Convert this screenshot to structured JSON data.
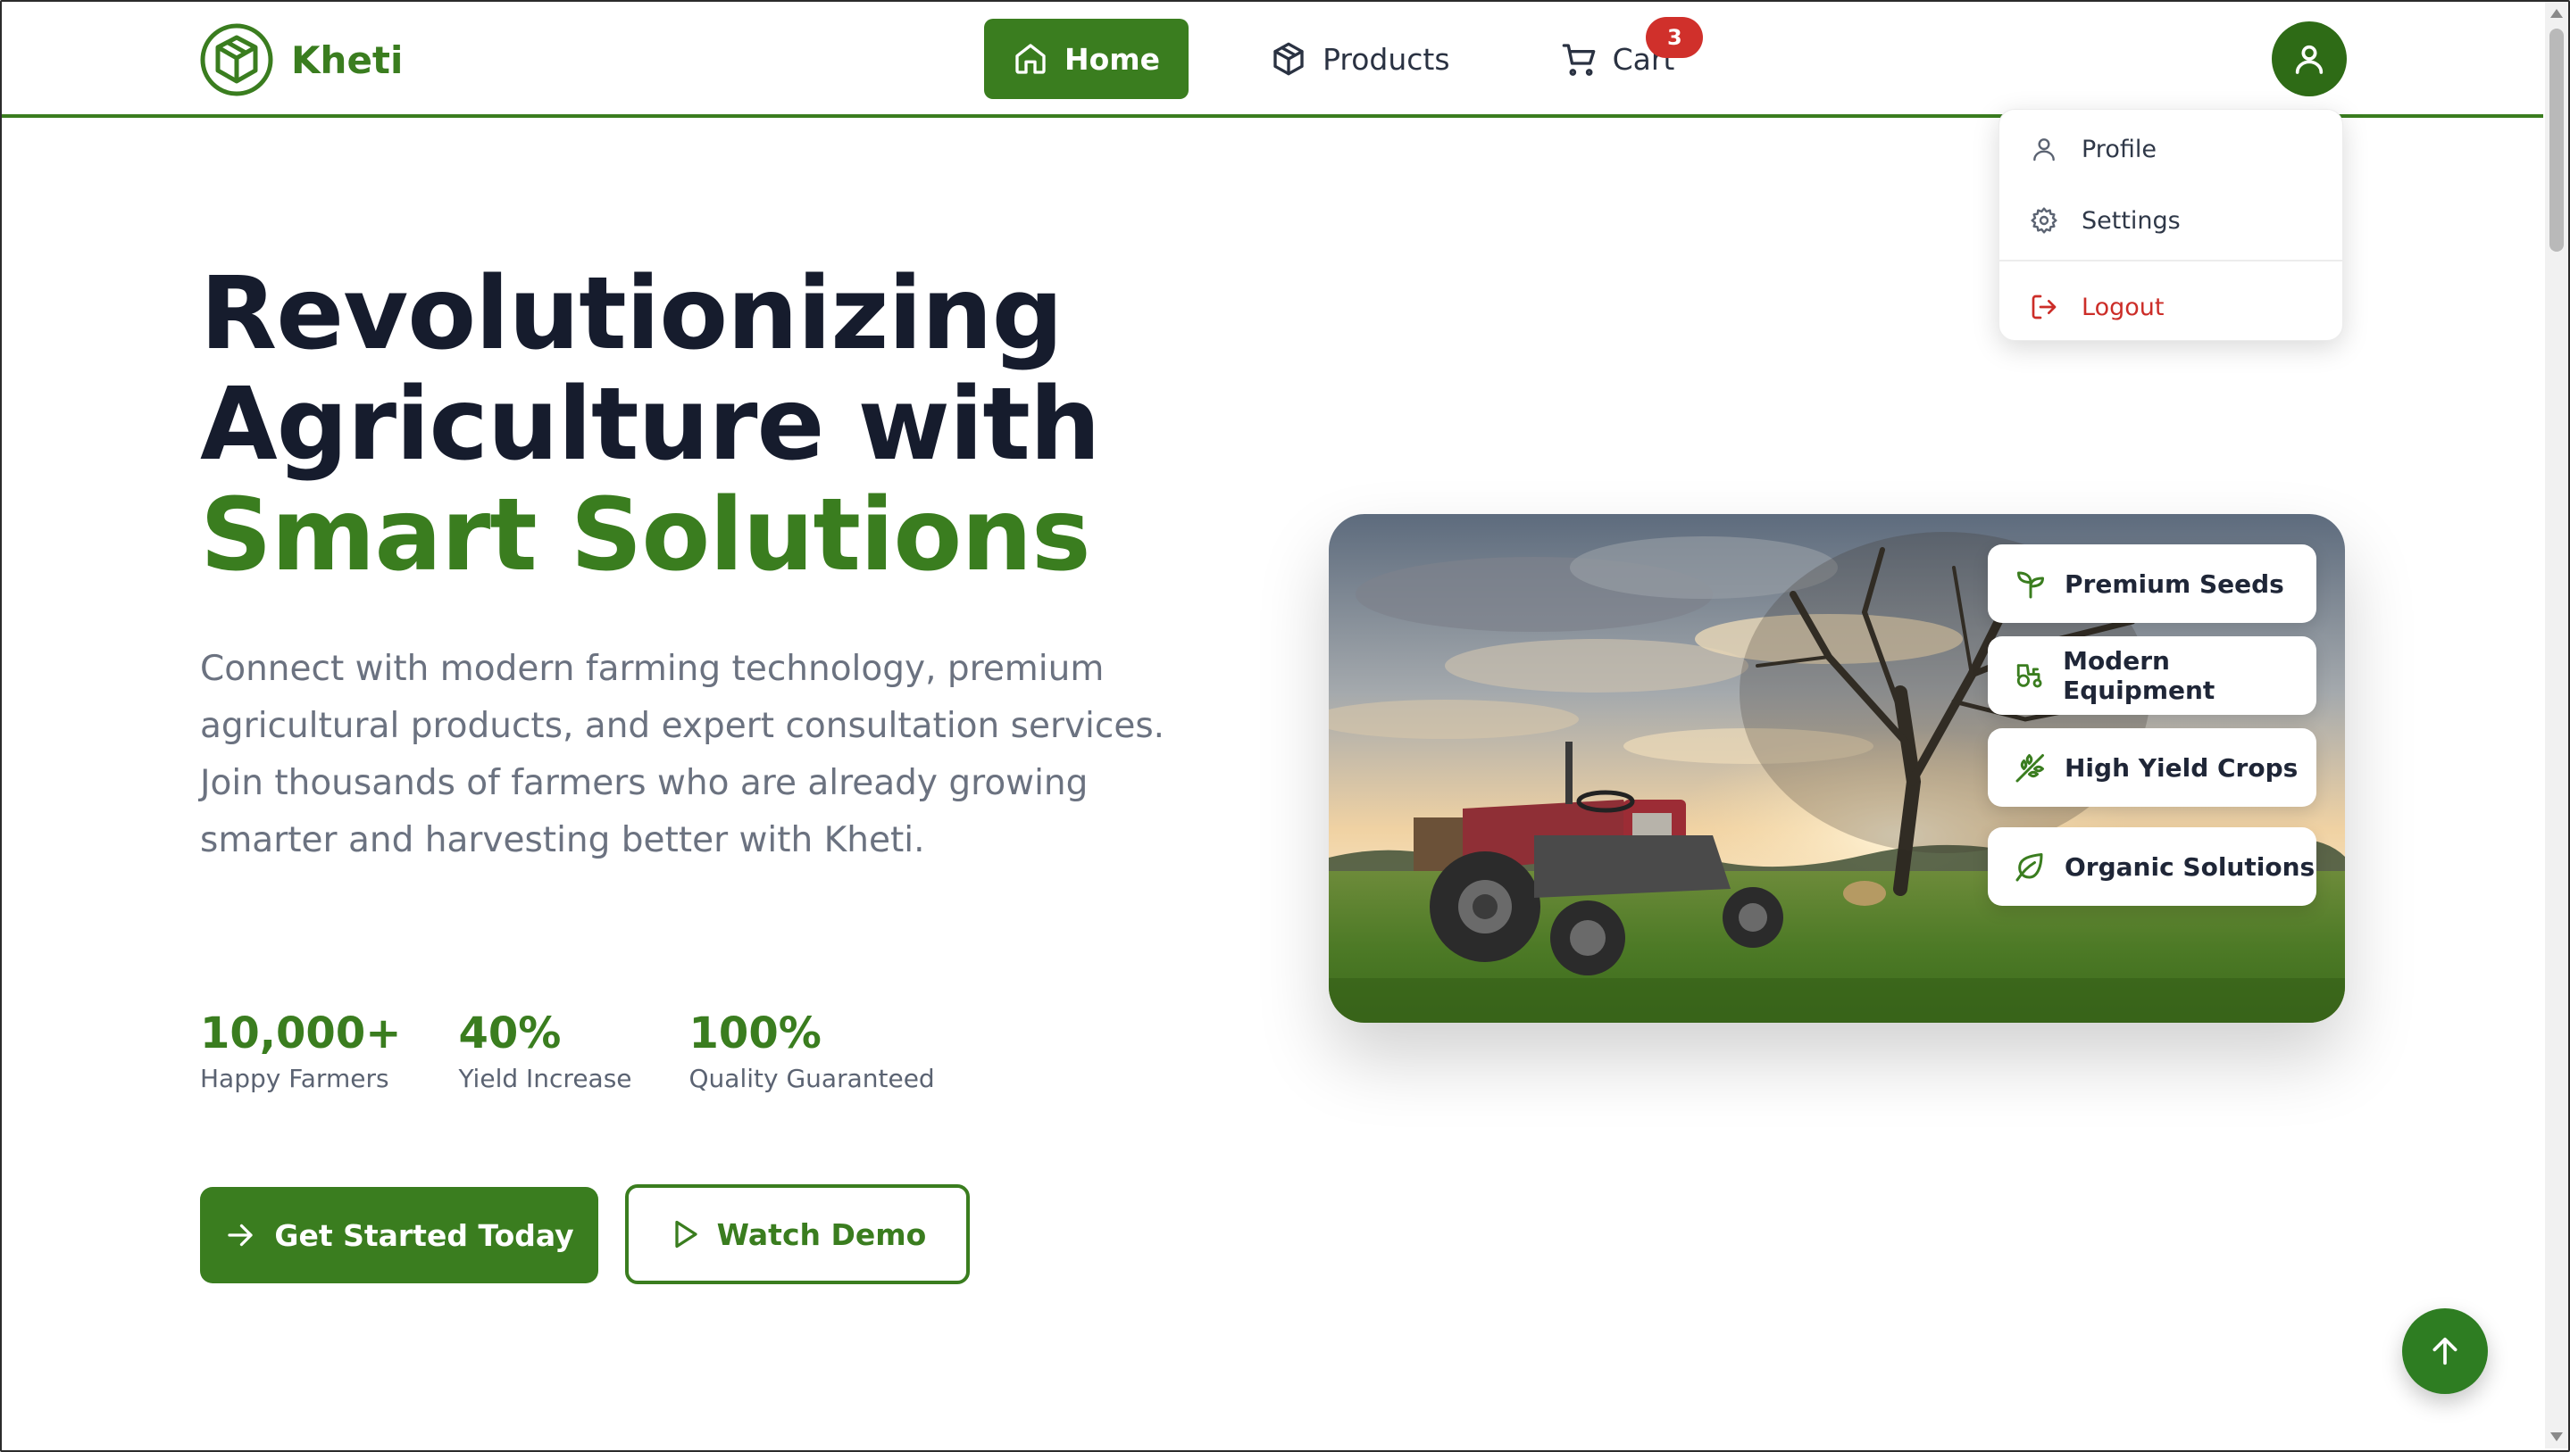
{
  "brand": {
    "name": "Kheti",
    "logo_icon": "box-logo-icon"
  },
  "nav": {
    "items": [
      {
        "label": "Home",
        "icon": "home-icon",
        "active": true
      },
      {
        "label": "Products",
        "icon": "package-icon",
        "active": false
      },
      {
        "label": "Cart",
        "icon": "cart-icon",
        "active": false
      }
    ],
    "cart_count": "3"
  },
  "user_menu": {
    "avatar_icon": "user-icon",
    "items": [
      {
        "label": "Profile",
        "icon": "user-icon"
      },
      {
        "label": "Settings",
        "icon": "gear-icon"
      },
      {
        "label": "Logout",
        "icon": "logout-icon"
      }
    ]
  },
  "hero": {
    "title_line1": "Revolutionizing",
    "title_line2": "Agriculture with",
    "title_highlight": "Smart Solutions",
    "description": "Connect with modern farming technology, premium agricultural products, and expert consultation services. Join thousands of farmers who are already growing smarter and harvesting better with Kheti.",
    "stats": [
      {
        "value": "10,000+",
        "label": "Happy Farmers"
      },
      {
        "value": "40%",
        "label": "Yield Increase"
      },
      {
        "value": "100%",
        "label": "Quality Guaranteed"
      }
    ],
    "primary_button": "Get Started Today",
    "secondary_button": "Watch Demo",
    "image_icon": "tractor-field-image",
    "features": [
      {
        "label": "Premium Seeds",
        "icon": "sprout-icon"
      },
      {
        "label": "Modern Equipment",
        "icon": "tractor-icon"
      },
      {
        "label": "High Yield Crops",
        "icon": "wheat-icon"
      },
      {
        "label": "Organic Solutions",
        "icon": "leaf-icon"
      }
    ]
  },
  "colors": {
    "primary": "#3a7d1f",
    "primary_dark": "#2e6b16",
    "heading": "#161c2d",
    "muted_text": "#6b7280",
    "badge": "#d0302b",
    "logout": "#cc2d28"
  },
  "scroll_top_icon": "arrow-up-icon"
}
